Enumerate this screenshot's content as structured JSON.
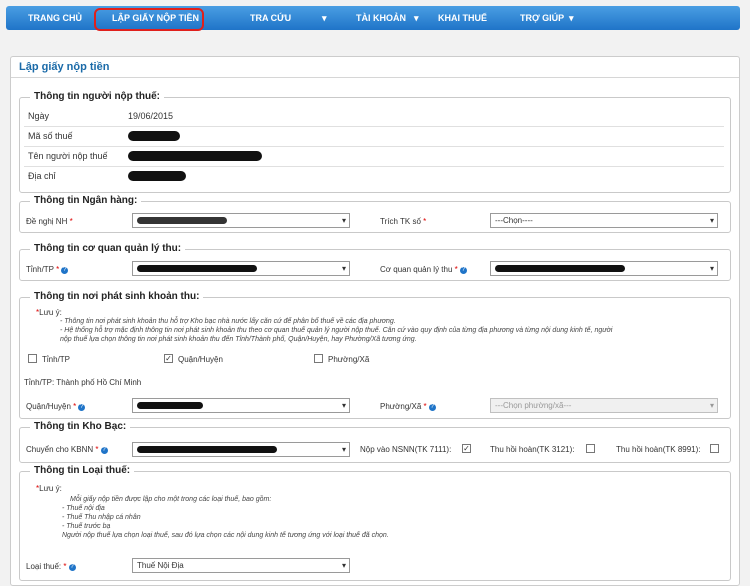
{
  "nav": {
    "items": [
      {
        "label": "TRANG CHỦ"
      },
      {
        "label": "LẬP GIẤY NỘP TIỀN"
      },
      {
        "label": "TRA CỨU"
      },
      {
        "label": "TÀI KHOẢN"
      },
      {
        "label": "KHAI THUẾ"
      },
      {
        "label": "TRỢ GIÚP"
      }
    ]
  },
  "page": {
    "title": "Lập giấy nộp tiền"
  },
  "taxpayer": {
    "legend": "Thông tin người nộp thuế:",
    "rows": [
      {
        "label": "Ngày",
        "value": "19/06/2015"
      },
      {
        "label": "Mã số thuế",
        "value": ""
      },
      {
        "label": "Tên người nộp thuế",
        "value": ""
      },
      {
        "label": "Địa chỉ",
        "value": ""
      }
    ]
  },
  "bank": {
    "legend": "Thông tin Ngân hàng:",
    "bank_label": "Đề nghị NH",
    "bank_value": "",
    "account_label": "Trích TK số",
    "account_value": "---Chọn----"
  },
  "authority": {
    "legend": "Thông tin cơ quan quản lý thu:",
    "province_label": "Tỉnh/TP",
    "agency_label": "Cơ quan quản lý thu"
  },
  "origin": {
    "legend": "Thông tin nơi phát sinh khoản thu:",
    "note_title": "Lưu ý:",
    "note_lines": [
      "- Thông tin nơi phát sinh khoản thu hỗ trợ Kho bạc nhà nước lấy căn cứ để phân bổ thuế về các địa phương.",
      "- Hệ thống hỗ trợ mặc định thông tin nơi phát sinh khoản thu theo cơ quan thuế quản lý người nộp thuế. Căn cứ vào quy định của từng địa phương và từng nội dung kinh tế, người",
      "nộp thuế lựa chọn thông tin nơi phát sinh khoản thu đến Tỉnh/Thành phố, Quận/Huyện, hay Phường/Xã tương ứng."
    ],
    "checkbox_province": "Tỉnh/TP",
    "checkbox_district": "Quận/Huyện",
    "checkbox_ward": "Phường/Xã",
    "province_text": "Tỉnh/TP: Thành phố Hồ Chí Minh",
    "district_label": "Quận/Huyện",
    "ward_label": "Phường/Xã",
    "ward_value": "---Chọn phường/xã---"
  },
  "treasury": {
    "legend": "Thông tin Kho Bạc:",
    "transfer_label": "Chuyển cho KBNN",
    "nsnn_label": "Nộp vào NSNN(TK 7111):",
    "refund1_label": "Thu hồi hoàn(TK 3121):",
    "refund2_label": "Thu hồi hoàn(TK 8991):"
  },
  "taxtype": {
    "legend": "Thông tin Loại thuế:",
    "note_title": "Lưu ý:",
    "note_lines": [
      "Mỗi giấy nộp tiền được lập cho một trong các loại thuế, bao gồm:",
      "- Thuế nội địa",
      "- Thuế Thu nhập cá nhân",
      "- Thuế trước bạ",
      "Người nộp thuế lựa chọn loại thuế, sau đó lựa chọn các nội dung kinh tế tương ứng với loại thuế đã chọn."
    ],
    "type_label": "Loại thuế:",
    "type_value": "Thuế Nội Địa"
  },
  "colors": {
    "nav": "#1f74c8",
    "title": "#1a6aa8",
    "highlight": "#e0201c",
    "required": "#d00000"
  }
}
